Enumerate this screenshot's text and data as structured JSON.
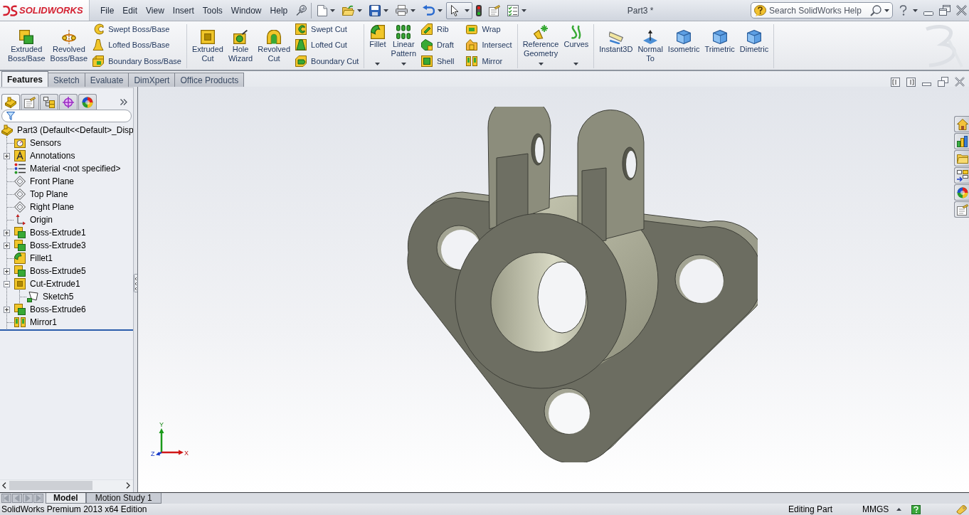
{
  "app": {
    "logo_text": "SOLIDWORKS"
  },
  "menu": [
    "File",
    "Edit",
    "View",
    "Insert",
    "Tools",
    "Window",
    "Help"
  ],
  "quick_access": [
    {
      "dropdown": true,
      "pressed": false
    },
    {
      "dropdown": true,
      "pressed": false
    },
    {
      "dropdown": true,
      "pressed": false
    },
    {
      "dropdown": true,
      "pressed": false
    },
    {
      "dropdown": true,
      "pressed": false
    },
    {
      "dropdown": true,
      "pressed": true
    },
    {
      "dropdown": false,
      "pressed": false
    },
    {
      "dropdown": false,
      "pressed": false
    },
    {
      "dropdown": true,
      "pressed": false
    }
  ],
  "window": {
    "title": "Part3 *"
  },
  "search": {
    "placeholder": "Search SolidWorks Help"
  },
  "command_manager": {
    "groups": [
      {
        "items": [
          {
            "kind": "large",
            "label": "Extruded\nBoss/Base",
            "dropdown": false
          },
          {
            "kind": "large",
            "label": "Revolved\nBoss/Base",
            "dropdown": false
          },
          {
            "kind": "stack",
            "buttons": [
              "Swept Boss/Base",
              "Lofted Boss/Base",
              "Boundary Boss/Base"
            ]
          }
        ]
      },
      {
        "items": [
          {
            "kind": "large",
            "label": "Extruded\nCut",
            "dropdown": false
          },
          {
            "kind": "large",
            "label": "Hole\nWizard",
            "dropdown": false
          },
          {
            "kind": "large",
            "label": "Revolved\nCut",
            "dropdown": false
          },
          {
            "kind": "stack",
            "buttons": [
              "Swept Cut",
              "Lofted Cut",
              "Boundary Cut"
            ]
          }
        ]
      },
      {
        "items": [
          {
            "kind": "large",
            "label": "Fillet",
            "dropdown": true
          },
          {
            "kind": "large",
            "label": "Linear\nPattern",
            "dropdown": true
          },
          {
            "kind": "stack",
            "buttons": [
              "Rib",
              "Draft",
              "Shell"
            ]
          },
          {
            "kind": "stack",
            "buttons": [
              "Wrap",
              "Intersect",
              "Mirror"
            ]
          }
        ]
      },
      {
        "items": [
          {
            "kind": "large",
            "label": "Reference\nGeometry",
            "dropdown": true
          },
          {
            "kind": "large",
            "label": "Curves",
            "dropdown": true
          }
        ]
      },
      {
        "items": [
          {
            "kind": "large",
            "label": "Instant3D",
            "dropdown": false
          },
          {
            "kind": "large",
            "label": "Normal\nTo",
            "dropdown": false
          },
          {
            "kind": "large",
            "label": "Isometric",
            "dropdown": false
          },
          {
            "kind": "large",
            "label": "Trimetric",
            "dropdown": false
          },
          {
            "kind": "large",
            "label": "Dimetric",
            "dropdown": false
          }
        ]
      }
    ]
  },
  "command_tabs": [
    {
      "label": "Features",
      "selected": true
    },
    {
      "label": "Sketch",
      "selected": false
    },
    {
      "label": "Evaluate",
      "selected": false
    },
    {
      "label": "DimXpert",
      "selected": false
    },
    {
      "label": "Office Products",
      "selected": false
    }
  ],
  "feature_manager": {
    "tabs": [
      {
        "selected": true
      },
      {
        "selected": false
      },
      {
        "selected": false
      },
      {
        "selected": false
      },
      {
        "selected": false
      }
    ],
    "tree": {
      "label": "Part3 (Default<<Default>_Disp",
      "kind": "part",
      "children": [
        {
          "label": "Sensors",
          "kind": "sensors"
        },
        {
          "label": "Annotations",
          "kind": "annotations",
          "expanded": false
        },
        {
          "label": "Material <not specified>",
          "kind": "material"
        },
        {
          "label": "Front Plane",
          "kind": "plane"
        },
        {
          "label": "Top Plane",
          "kind": "plane"
        },
        {
          "label": "Right Plane",
          "kind": "plane"
        },
        {
          "label": "Origin",
          "kind": "origin"
        },
        {
          "label": "Boss-Extrude1",
          "kind": "boss",
          "expanded": false
        },
        {
          "label": "Boss-Extrude3",
          "kind": "boss",
          "expanded": false
        },
        {
          "label": "Fillet1",
          "kind": "fillet"
        },
        {
          "label": "Boss-Extrude5",
          "kind": "boss",
          "expanded": false
        },
        {
          "label": "Cut-Extrude1",
          "kind": "cut",
          "expanded": true,
          "children": [
            {
              "label": "Sketch5",
              "kind": "sketch"
            }
          ]
        },
        {
          "label": "Boss-Extrude6",
          "kind": "boss",
          "expanded": false
        },
        {
          "label": "Mirror1",
          "kind": "mirror"
        }
      ]
    }
  },
  "viewport": {
    "triad": {
      "axes": [
        "Y",
        "X",
        "Z"
      ]
    }
  },
  "bottom_tabs": [
    {
      "label": "Model",
      "selected": true
    },
    {
      "label": "Motion Study 1",
      "selected": false
    }
  ],
  "status_bar": {
    "edition": "SolidWorks Premium 2013 x64 Edition",
    "mode": "Editing Part",
    "units": "MMGS"
  }
}
